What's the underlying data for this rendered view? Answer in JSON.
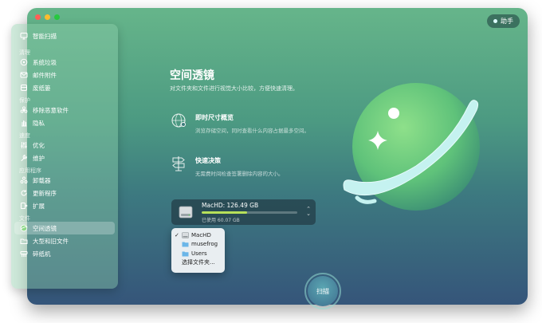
{
  "window": {
    "assistant_label": "助手"
  },
  "sidebar": {
    "top_item": {
      "label": "智能扫描",
      "icon": "monitor-icon"
    },
    "sections": [
      {
        "title": "清理",
        "items": [
          {
            "label": "系统垃圾",
            "icon": "gear-circle-icon"
          },
          {
            "label": "邮件附件",
            "icon": "mail-icon"
          },
          {
            "label": "废纸篓",
            "icon": "trash-icon"
          }
        ]
      },
      {
        "title": "保护",
        "items": [
          {
            "label": "移除恶意软件",
            "icon": "biohazard-icon"
          },
          {
            "label": "隐私",
            "icon": "hand-icon"
          }
        ]
      },
      {
        "title": "速度",
        "items": [
          {
            "label": "优化",
            "icon": "sliders-icon"
          },
          {
            "label": "维护",
            "icon": "wrench-icon"
          }
        ]
      },
      {
        "title": "应用程序",
        "items": [
          {
            "label": "卸载器",
            "icon": "apps-icon"
          },
          {
            "label": "更新程序",
            "icon": "refresh-icon"
          },
          {
            "label": "扩展",
            "icon": "extension-icon"
          }
        ]
      },
      {
        "title": "文件",
        "items": [
          {
            "label": "空间透镜",
            "icon": "lens-icon",
            "active": true
          },
          {
            "label": "大型和旧文件",
            "icon": "folder-icon"
          },
          {
            "label": "碎纸机",
            "icon": "shredder-icon"
          }
        ]
      }
    ]
  },
  "main": {
    "title": "空间透镜",
    "description": "对文件夹和文件进行视觉大小比较，方便快速清理。",
    "features": [
      {
        "title": "即时尺寸概览",
        "description": "浏览存储空间，同时查看什么内容占据最多空间。",
        "icon": "globe-icon"
      },
      {
        "title": "快速决策",
        "description": "无需费时间检查签署删除内容的大小。",
        "icon": "signpost-icon"
      }
    ]
  },
  "disk": {
    "name": "MacHD: 126.49 GB",
    "used": "已使用 60.07 GB",
    "used_fraction": 0.475
  },
  "dropdown": {
    "items": [
      {
        "label": "MacHD",
        "checked": true,
        "icon": "disk-icon"
      },
      {
        "label": "musefrog",
        "checked": false,
        "icon": "folder-icon"
      },
      {
        "label": "Users",
        "checked": false,
        "icon": "folder-icon"
      },
      {
        "label": "选择文件夹...",
        "checked": false,
        "icon": ""
      }
    ]
  },
  "scan_button": {
    "label": "扫描"
  },
  "colors": {
    "accent_green": "#b7e05a",
    "planet_green": "#7fd07a",
    "ring_cyan": "#bff2f0"
  }
}
